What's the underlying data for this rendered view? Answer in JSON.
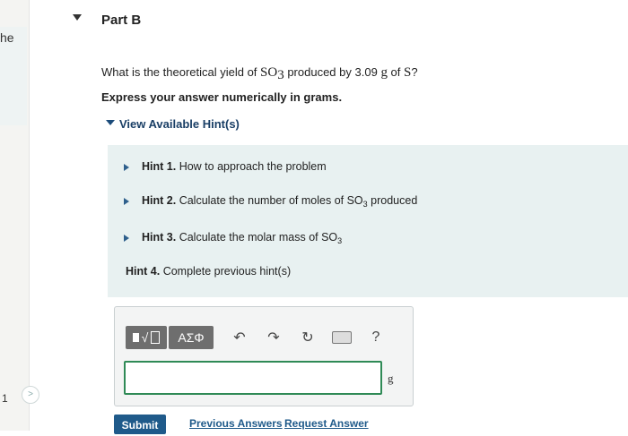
{
  "sidebar": {
    "partial_text": "he",
    "item_number": "1",
    "next_glyph": ">"
  },
  "part": {
    "title": "Part B"
  },
  "question": {
    "prefix": "What is the theoretical yield of ",
    "chem1_base": "SO",
    "chem1_sub": "3",
    "middle": " produced by ",
    "mass": "3.09",
    "unit_g": "g",
    "of": " of ",
    "chem2": "S",
    "suffix": "?"
  },
  "instruction": "Express your answer numerically in grams.",
  "hints_toggle": "View Available Hint(s)",
  "hints": [
    {
      "label": "Hint 1.",
      "text": "How to approach the problem",
      "sub": "",
      "expandable": true
    },
    {
      "label": "Hint 2.",
      "text": "Calculate the number of moles of SO",
      "sub": "3",
      "after": " produced",
      "expandable": true
    },
    {
      "label": "Hint 3.",
      "text": "Calculate the molar mass of SO",
      "sub": "3",
      "after": "",
      "expandable": true
    },
    {
      "label": "Hint 4.",
      "text": "Complete previous hint(s)",
      "sub": "",
      "after": "",
      "expandable": false
    }
  ],
  "toolbar": {
    "templates_label": "√",
    "greek_label": "ΑΣΦ",
    "undo_icon": "undo-icon",
    "redo_icon": "redo-icon",
    "reset_icon": "reset-icon",
    "keyboard_icon": "keyboard-icon",
    "help_label": "?"
  },
  "answer": {
    "value": "",
    "unit": "g"
  },
  "actions": {
    "submit": "Submit",
    "previous_answers": "Previous Answers",
    "request_answer": "Request Answer"
  },
  "colors": {
    "link": "#1f5a8a",
    "hint_panel": "#e8f1f1",
    "input_border": "#2f8a56"
  }
}
